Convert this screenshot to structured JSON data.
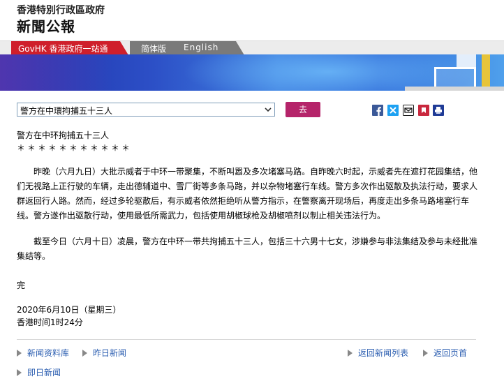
{
  "masthead": {
    "org": "香港特別行政區政府",
    "title": "新聞公報"
  },
  "nav": {
    "govhk": "GovHK 香港政府一站通",
    "simplified": "简体版",
    "english": "English"
  },
  "toolbar": {
    "selected_headline": "警方在中環拘捕五十三人",
    "go_label": "去"
  },
  "share_icons": [
    "facebook-icon",
    "twitter-icon",
    "email-icon",
    "bookmark-icon",
    "print-icon"
  ],
  "article": {
    "title": "警方在中环拘捕五十三人",
    "stars": "＊＊＊＊＊＊＊＊＊＊＊",
    "para1": "昨晚（六月九日）大批示威者于中环一带聚集，不断叫嚣及多次堵塞马路。自昨晚六时起，示威者先在遮打花园集结，他们无视路上正行驶的车辆，走出德辅道中、雪厂街等多条马路，并以杂物堵塞行车线。警方多次作出驱散及执法行动，要求人群返回行人路。然而，经过多轮驱散后，有示威者依然拒绝听从警方指示，在警察离开现场后，再度走出多条马路堵塞行车线。警方遂作出驱散行动，使用最低所需武力，包括使用胡椒球枪及胡椒喷剂以制止相关违法行为。",
    "para2": "截至今日（六月十日）凌晨，警方在中环一带共拘捕五十三人，包括三十六男十七女，涉嫌参与非法集结及参与未经批准集结等。",
    "end": "完",
    "date": "2020年6月10日（星期三）",
    "time": "香港时间1时24分"
  },
  "footer": {
    "archive": "新闻资料库",
    "yesterday": "昨日新闻",
    "back_list": "返回新闻列表",
    "back_top": "返回页首",
    "today": "即日新闻"
  }
}
